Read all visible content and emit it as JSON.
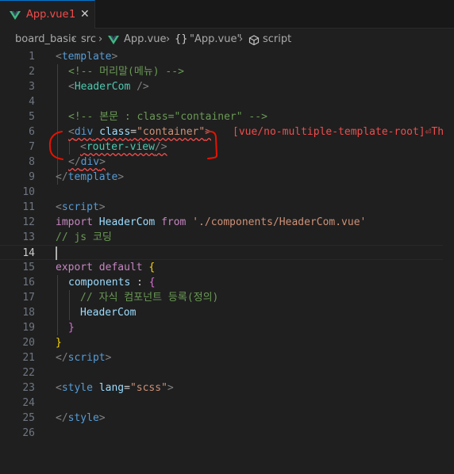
{
  "tab": {
    "filename": "App.vue",
    "problem_count": "1",
    "close_glyph": "✕"
  },
  "breadcrumb": {
    "project": "board_basic",
    "folder": "src",
    "file": "App.vue",
    "symbol1_icon": "{}",
    "symbol1": "\"App.vue\"",
    "symbol2": "script"
  },
  "editor": {
    "current_line": 14,
    "lines": [
      {
        "n": "1"
      },
      {
        "n": "2"
      },
      {
        "n": "3"
      },
      {
        "n": "4"
      },
      {
        "n": "5"
      },
      {
        "n": "6"
      },
      {
        "n": "7"
      },
      {
        "n": "8"
      },
      {
        "n": "9"
      },
      {
        "n": "10"
      },
      {
        "n": "11"
      },
      {
        "n": "12"
      },
      {
        "n": "13"
      },
      {
        "n": "14"
      },
      {
        "n": "15"
      },
      {
        "n": "16"
      },
      {
        "n": "17"
      },
      {
        "n": "18"
      },
      {
        "n": "19"
      },
      {
        "n": "20"
      },
      {
        "n": "21"
      },
      {
        "n": "22"
      },
      {
        "n": "23"
      },
      {
        "n": "24"
      },
      {
        "n": "25"
      },
      {
        "n": "26"
      }
    ],
    "code": {
      "l1_tag": "template",
      "l2_comment": "<!-- 머리말(메뉴) -->",
      "l3_comp": "HeaderCom",
      "l5_comment": "<!-- 본문 : class=\"container\" -->",
      "l6_tag": "div",
      "l6_attr": "class",
      "l6_val": "\"container\"",
      "l6_error": "[vue/no-multiple-template-root]⏎The",
      "l7_tag": "router-view",
      "l8_tag": "div",
      "l9_tag": "template",
      "l11_tag": "script",
      "l12_kw1": "import",
      "l12_name": "HeaderCom",
      "l12_kw2": "from",
      "l12_path": "'./components/HeaderCom.vue'",
      "l13_comment": "// js 코딩",
      "l15_kw1": "export",
      "l15_kw2": "default",
      "l16_prop": "components",
      "l17_comment": "// 자식 컴포넌트 등록(정의)",
      "l18_comp": "HeaderCom",
      "l20_brace": "}",
      "l21_tag": "script",
      "l23_tag": "style",
      "l23_attr": "lang",
      "l23_val": "\"scss\"",
      "l25_tag": "style"
    }
  },
  "colors": {
    "error": "#f14c4c",
    "tag": "#569cd6",
    "string": "#ce9178",
    "comment": "#6a9955",
    "component": "#4ec9b0",
    "keyword": "#c586c0",
    "annotation": "#e51400"
  }
}
